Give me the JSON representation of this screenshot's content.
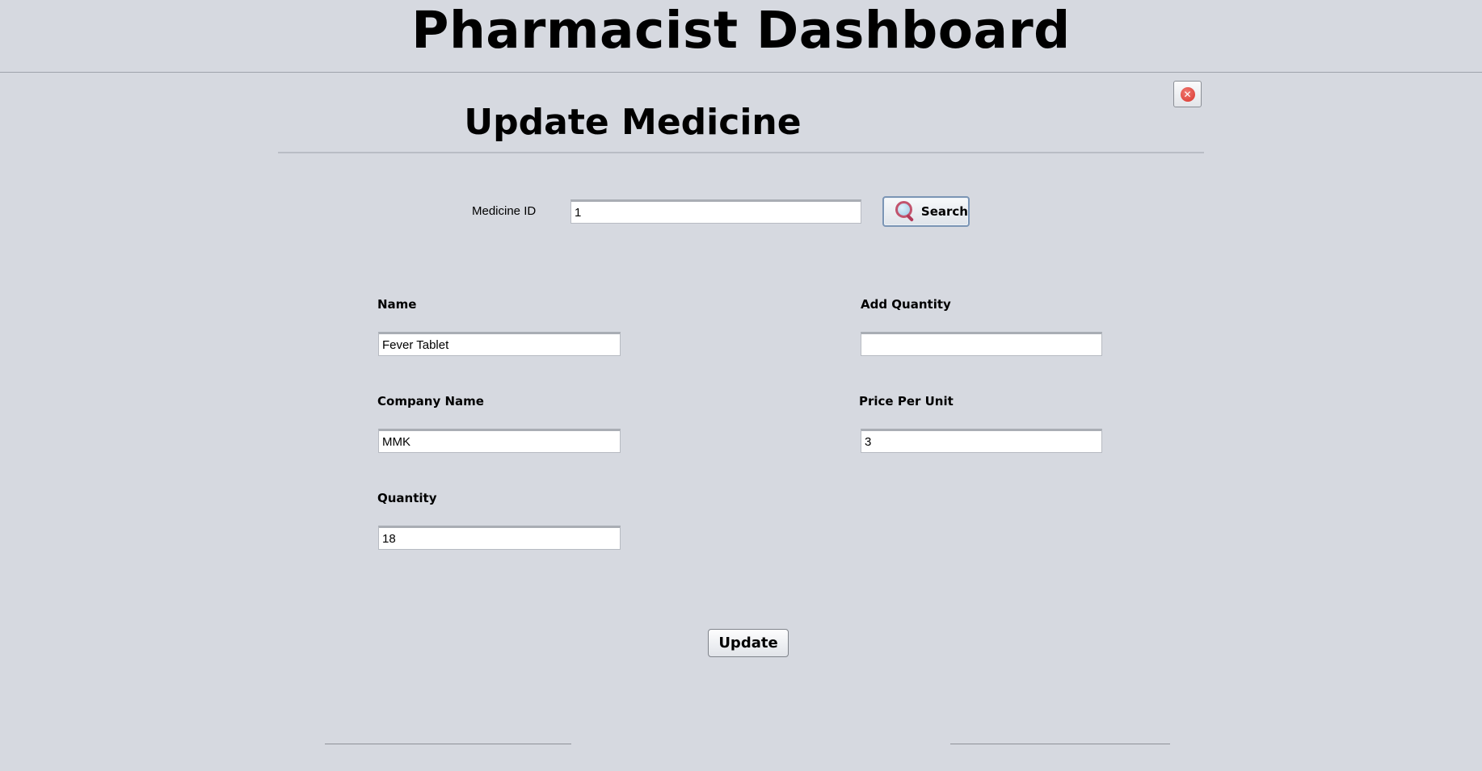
{
  "header": {
    "title": "Pharmacist Dashboard"
  },
  "panel": {
    "title": "Update Medicine",
    "close_icon": "close-icon",
    "close_color": "#d9332b"
  },
  "search": {
    "label": "Medicine ID",
    "value": "1",
    "button_label": "Search",
    "button_icon": "search-icon"
  },
  "form": {
    "name_label": "Name",
    "name_value": "Fever Tablet",
    "company_label": "Company Name",
    "company_value": "MMK",
    "quantity_label": "Quantity",
    "quantity_value": "18",
    "add_quantity_label": "Add Quantity",
    "add_quantity_value": "",
    "price_label": "Price Per Unit",
    "price_value": "3"
  },
  "actions": {
    "update_label": "Update"
  },
  "colors": {
    "background": "#d6d9e0",
    "search_border": "#7b95b5"
  }
}
